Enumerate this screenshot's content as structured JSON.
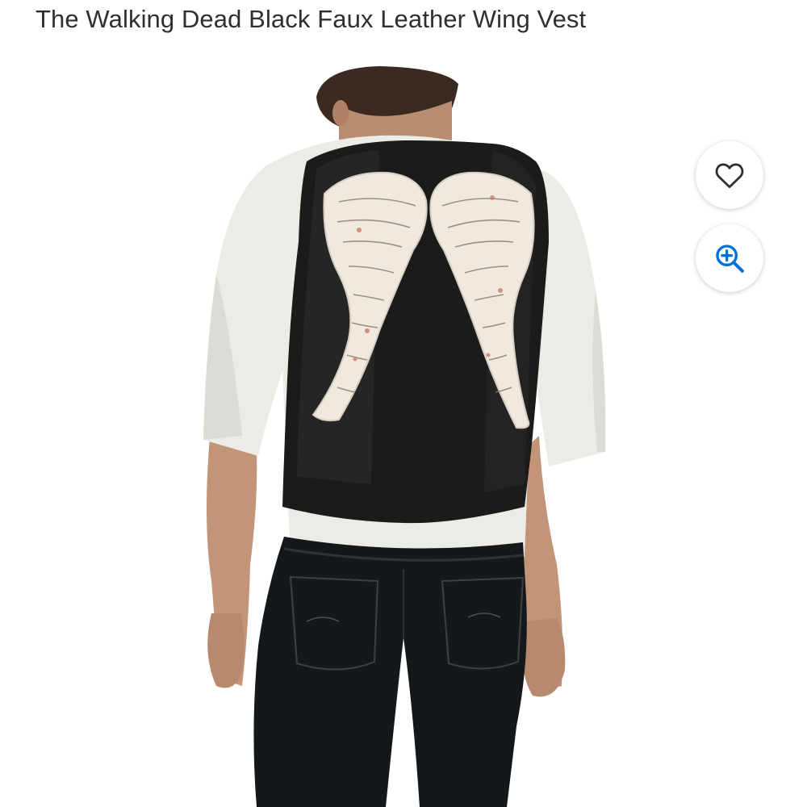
{
  "product": {
    "title": "The Walking Dead Black Faux Leather Wing Vest"
  },
  "actions": {
    "favorite_icon": "heart-icon",
    "zoom_icon": "zoom-in-icon"
  },
  "colors": {
    "title_text": "#2e2f32",
    "zoom_icon": "#0071dc",
    "heart_icon": "#2e2f32"
  }
}
